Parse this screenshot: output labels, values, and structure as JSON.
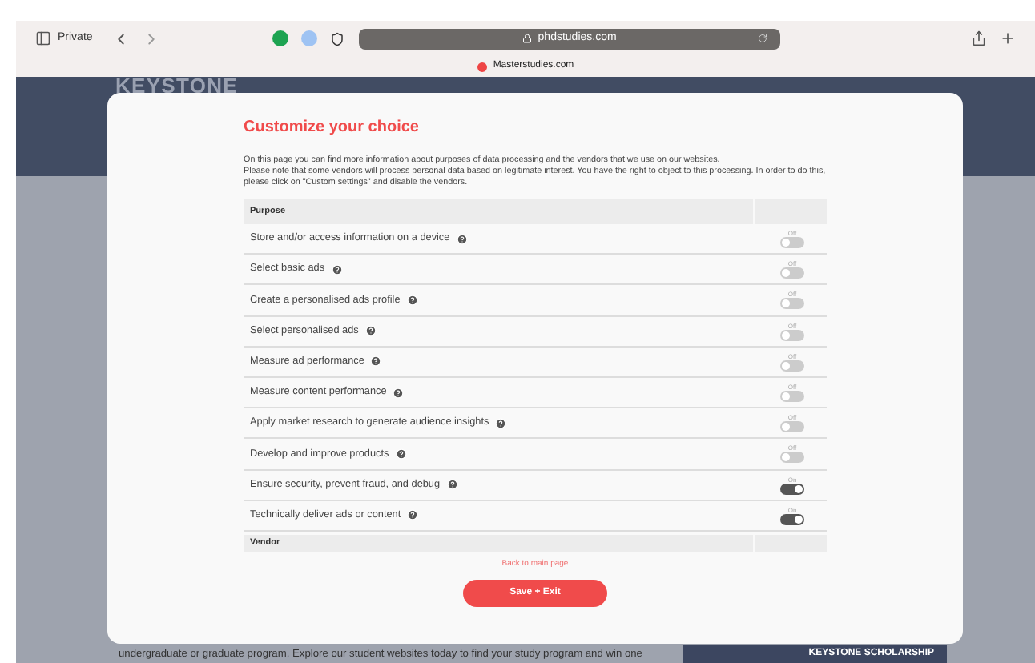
{
  "browser": {
    "private_label": "Private",
    "url": "phdstudies.com",
    "tab_title": "Masterstudies.com"
  },
  "site": {
    "logo": "KEYSTONE",
    "body_text": "undergraduate or graduate program. Explore our student websites today to find your study program and win one",
    "banner": "KEYSTONE SCHOLARSHIP"
  },
  "modal": {
    "title": "Customize your choice",
    "description": "On this page you can find more information about purposes of data processing and the vendors that we use on our websites.\nPlease note that some vendors will process personal data based on legitimate interest. You have the right to object to this processing. In order to do this, please click on \"Custom settings\" and disable the vendors.",
    "purpose_header": "Purpose",
    "purposes": [
      {
        "label": "Store and/or access information on a device",
        "state": "Off",
        "on": false
      },
      {
        "label": "Select basic ads",
        "state": "Off",
        "on": false
      },
      {
        "label": "Create a personalised ads profile",
        "state": "Off",
        "on": false
      },
      {
        "label": "Select personalised ads",
        "state": "Off",
        "on": false
      },
      {
        "label": "Measure ad performance",
        "state": "Off",
        "on": false
      },
      {
        "label": "Measure content performance",
        "state": "Off",
        "on": false
      },
      {
        "label": "Apply market research to generate audience insights",
        "state": "Off",
        "on": false
      },
      {
        "label": "Develop and improve products",
        "state": "Off",
        "on": false
      },
      {
        "label": "Ensure security, prevent fraud, and debug",
        "state": "On",
        "on": true
      },
      {
        "label": "Technically deliver ads or content",
        "state": "On",
        "on": true
      }
    ],
    "vendor_header": "Vendor",
    "back_link": "Back to main page",
    "save_button": "Save + Exit"
  }
}
